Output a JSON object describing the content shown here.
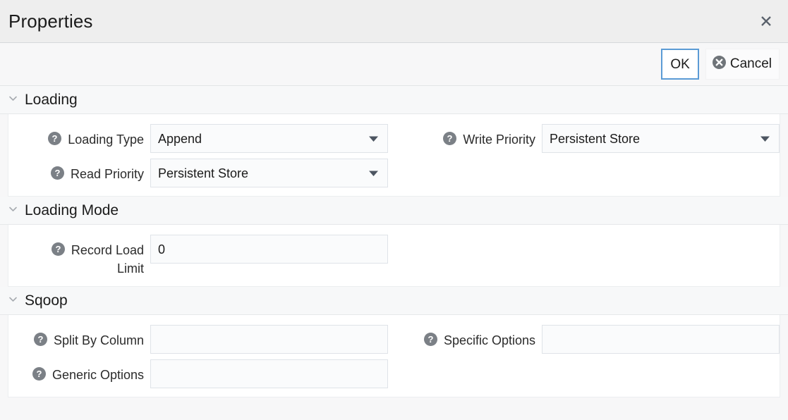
{
  "window": {
    "title": "Properties",
    "close_icon": "close-icon"
  },
  "toolbar": {
    "ok_label": "OK",
    "cancel_label": "Cancel",
    "cancel_icon": "circle-x-icon"
  },
  "sections": [
    {
      "title": "Loading",
      "collapse_icon": "chevron-down-icon",
      "rows": [
        {
          "left": {
            "help_icon": "help-icon",
            "label": "Loading Type",
            "type": "select",
            "value": "Append",
            "caret_icon": "triangle-down-icon"
          },
          "right": {
            "help_icon": "help-icon",
            "label": "Write Priority",
            "type": "select",
            "value": "Persistent Store",
            "caret_icon": "triangle-down-icon"
          }
        },
        {
          "left": {
            "help_icon": "help-icon",
            "label": "Read Priority",
            "type": "select",
            "value": "Persistent Store",
            "caret_icon": "triangle-down-icon"
          },
          "right": null
        }
      ]
    },
    {
      "title": "Loading Mode",
      "collapse_icon": "chevron-down-icon",
      "rows": [
        {
          "left": {
            "help_icon": "help-icon",
            "label": "Record Load\nLimit",
            "type": "text",
            "value": "0"
          },
          "right": null
        }
      ]
    },
    {
      "title": "Sqoop",
      "collapse_icon": "chevron-down-icon",
      "rows": [
        {
          "left": {
            "help_icon": "help-icon",
            "label": "Split By Column",
            "type": "text",
            "value": ""
          },
          "right": {
            "help_icon": "help-icon",
            "label": "Specific Options",
            "type": "text",
            "value": ""
          }
        },
        {
          "left": {
            "help_icon": "help-icon",
            "label": "Generic Options",
            "type": "text",
            "value": ""
          },
          "right": null
        }
      ]
    }
  ],
  "colors": {
    "titlebar_bg": "#eeeeee",
    "page_bg": "#f7f7f8",
    "panel_bg": "#ffffff",
    "field_bg": "#fafbfc",
    "field_border": "#dfe3e8",
    "focus_border": "#5b9bd5",
    "icon_gray": "#8a8d91",
    "text": "#1b1b1b"
  }
}
